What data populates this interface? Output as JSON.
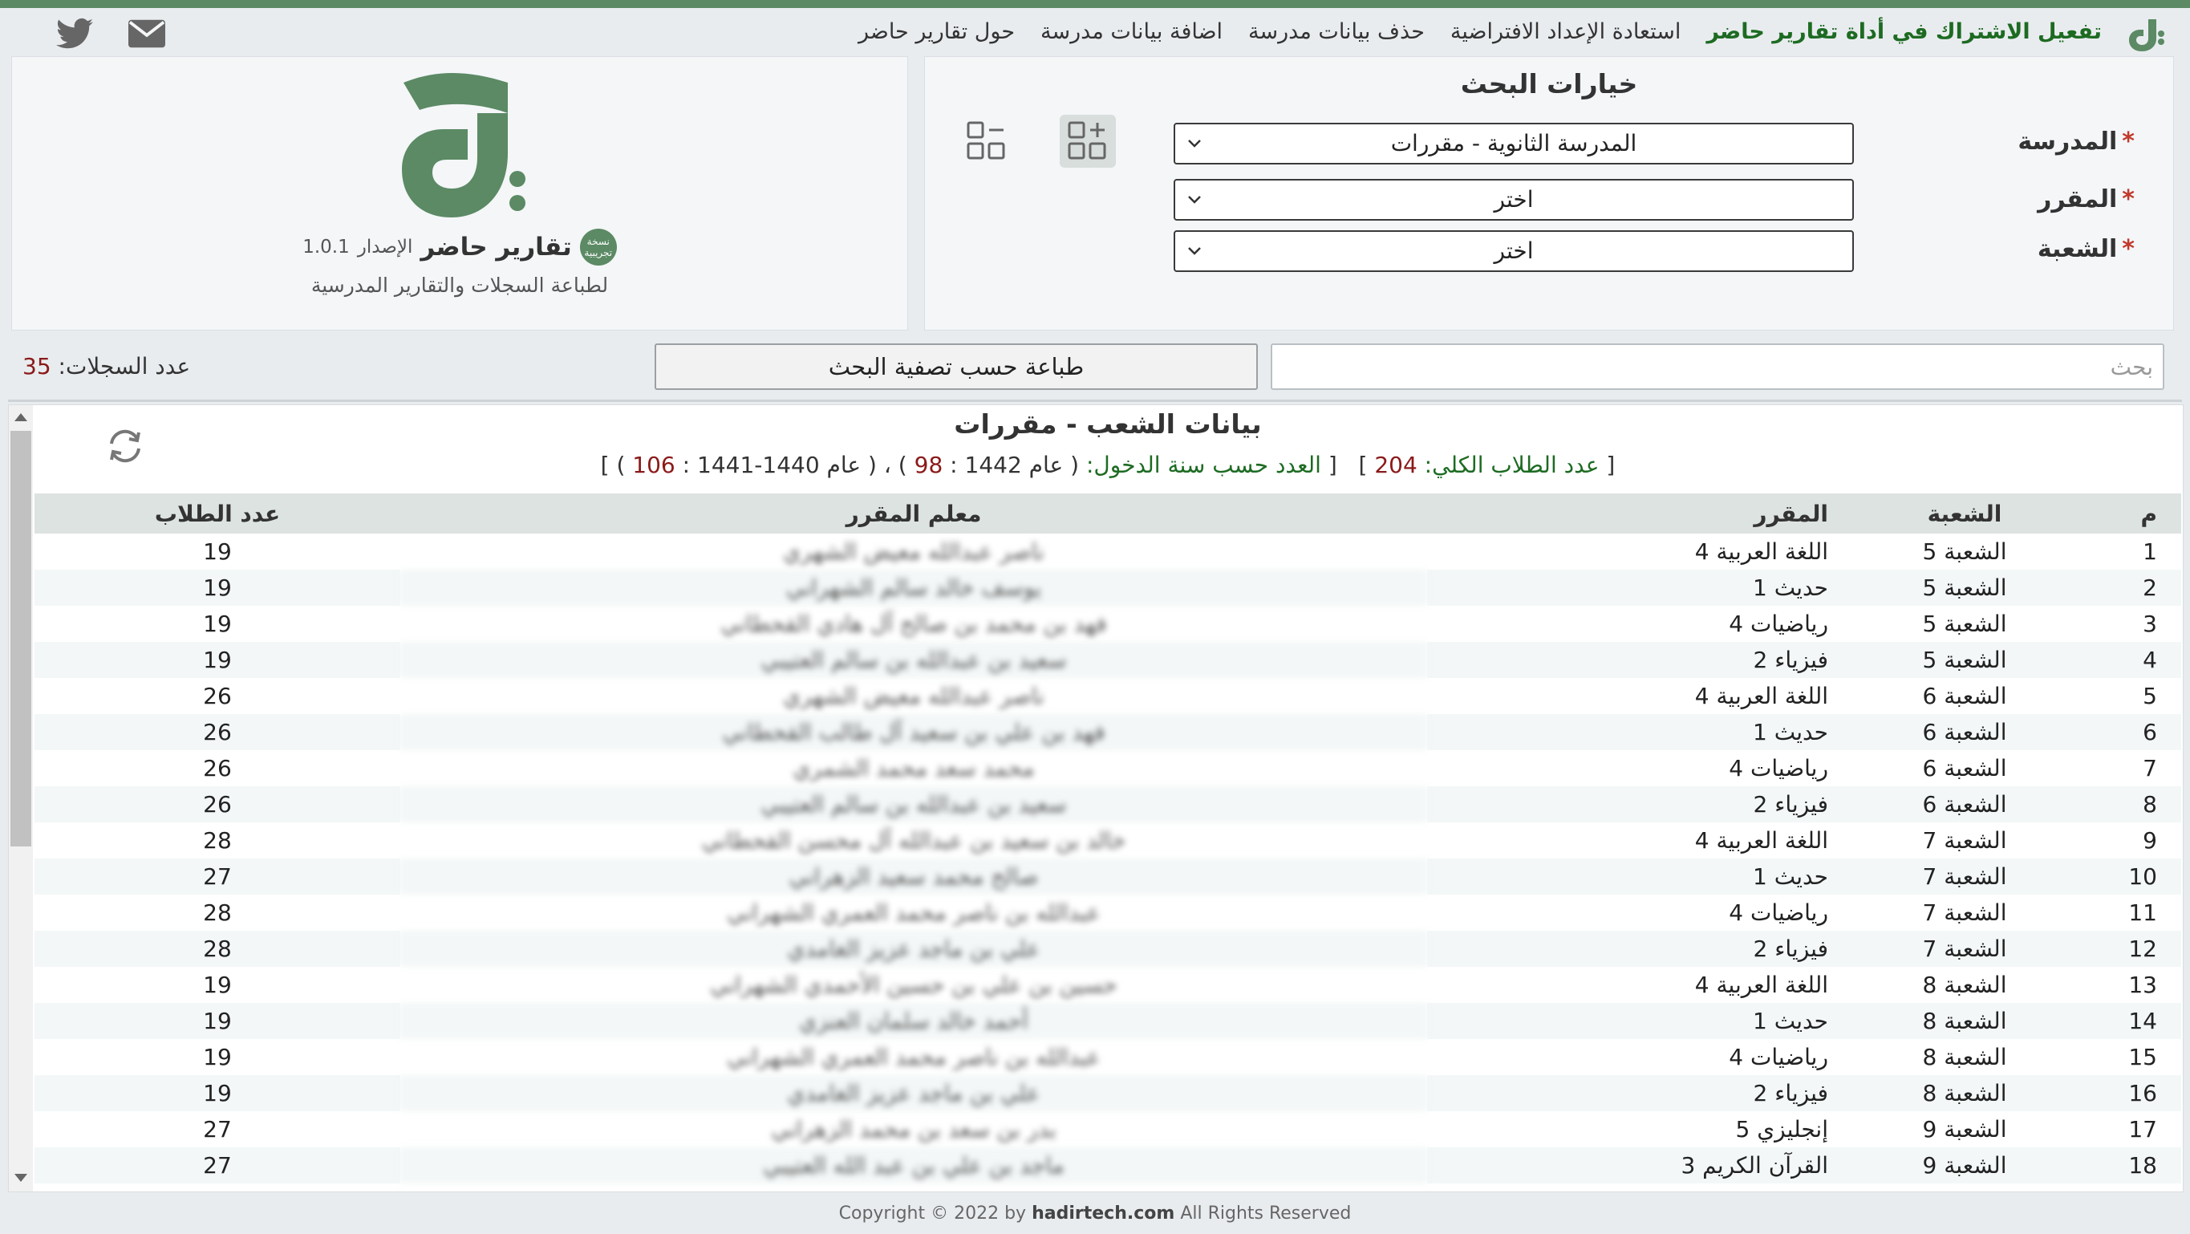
{
  "nav": {
    "links": [
      {
        "label": "حول تقارير حاضر",
        "green": false
      },
      {
        "label": "اضافة بيانات مدرسة",
        "green": false
      },
      {
        "label": "حذف بيانات مدرسة",
        "green": false
      },
      {
        "label": "استعادة الإعداد الافتراضية",
        "green": false
      },
      {
        "label": "تفعيل الاشتراك في أداة تقارير حاضر",
        "green": true
      }
    ],
    "icons": [
      "twitter-icon",
      "mail-icon"
    ]
  },
  "search_panel": {
    "title": "خيارات البحث",
    "school": {
      "label": "المدرسة",
      "value": "المدرسة الثانوية - مقررات"
    },
    "course": {
      "label": "المقرر",
      "value": "اختر"
    },
    "section": {
      "label": "الشعبة",
      "value": "اختر"
    },
    "required_mark": "*"
  },
  "brand": {
    "badge": "نسخة تجريبية",
    "name": "تقارير حاضر",
    "version_label": "الإصدار",
    "version": "1.0.1",
    "subtitle": "لطباعة السجلات والتقارير المدرسية"
  },
  "toolbar": {
    "search_placeholder": "بحث",
    "print_label": "طباعة حسب تصفية البحث",
    "records_label": "عدد السجلات:",
    "records_count": "35"
  },
  "table": {
    "title": "بيانات الشعب - مقررات",
    "stats": {
      "total_label": "عدد الطلاب الكلي:",
      "total": "204",
      "by_year_label": "العدد حسب سنة الدخول:",
      "year1_label": "عام 1442 :",
      "year1_count": "98",
      "year2_label": "عام 1440-1441 :",
      "year2_count": "106"
    },
    "headers": [
      "م",
      "الشعبة",
      "المقرر",
      "معلم المقرر",
      "عدد الطلاب"
    ],
    "rows": [
      [
        "1",
        "الشعبة 5",
        "اللغة العربية 4",
        "ناصر عبدالله معيض الشهري",
        "19"
      ],
      [
        "2",
        "الشعبة 5",
        "حديث 1",
        "يوسف خالد سالم الشهراني",
        "19"
      ],
      [
        "3",
        "الشعبة 5",
        "رياضيات 4",
        "فهد بن محمد بن صالح آل هادي القحطاني",
        "19"
      ],
      [
        "4",
        "الشعبة 5",
        "فيزياء 2",
        "سعيد بن عبدالله بن سالم العتيبي",
        "19"
      ],
      [
        "5",
        "الشعبة 6",
        "اللغة العربية 4",
        "ناصر عبدالله معيض الشهري",
        "26"
      ],
      [
        "6",
        "الشعبة 6",
        "حديث 1",
        "فهد بن علي بن سعيد آل طالب القحطاني",
        "26"
      ],
      [
        "7",
        "الشعبة 6",
        "رياضيات 4",
        "محمد سعد محمد الشمري",
        "26"
      ],
      [
        "8",
        "الشعبة 6",
        "فيزياء 2",
        "سعيد بن عبدالله بن سالم العتيبي",
        "26"
      ],
      [
        "9",
        "الشعبة 7",
        "اللغة العربية 4",
        "خالد بن سعيد بن عبدالله آل محسن القحطاني",
        "28"
      ],
      [
        "10",
        "الشعبة 7",
        "حديث 1",
        "صالح محمد سعيد الزهراني",
        "27"
      ],
      [
        "11",
        "الشعبة 7",
        "رياضيات 4",
        "عبدالله بن ناصر محمد العمري الشهراني",
        "28"
      ],
      [
        "12",
        "الشعبة 7",
        "فيزياء 2",
        "علي بن ماجد عزيز الغامدي",
        "28"
      ],
      [
        "13",
        "الشعبة 8",
        "اللغة العربية 4",
        "حسين بن علي بن حسين الأحمدي الشهراني",
        "19"
      ],
      [
        "14",
        "الشعبة 8",
        "حديث 1",
        "أحمد خالد سلمان العنزي",
        "19"
      ],
      [
        "15",
        "الشعبة 8",
        "رياضيات 4",
        "عبدالله بن ناصر محمد العمري الشهراني",
        "19"
      ],
      [
        "16",
        "الشعبة 8",
        "فيزياء 2",
        "علي بن ماجد عزيز الغامدي",
        "19"
      ],
      [
        "17",
        "الشعبة 9",
        "إنجليزي 5",
        "بدر بن سعد بن محمد الزهراني",
        "27"
      ],
      [
        "18",
        "الشعبة 9",
        "القرآن الكريم 3",
        "ماجد بن علي بن عبد الله العتيبي",
        "27"
      ]
    ]
  },
  "footer": {
    "prefix": "Copyright © 2022 by",
    "site": "hadirtech.com",
    "suffix": "All Rights Reserved"
  },
  "colors": {
    "accent": "#5b8a64",
    "link_green": "#1d6b22",
    "number_red": "#8b1a1a"
  }
}
